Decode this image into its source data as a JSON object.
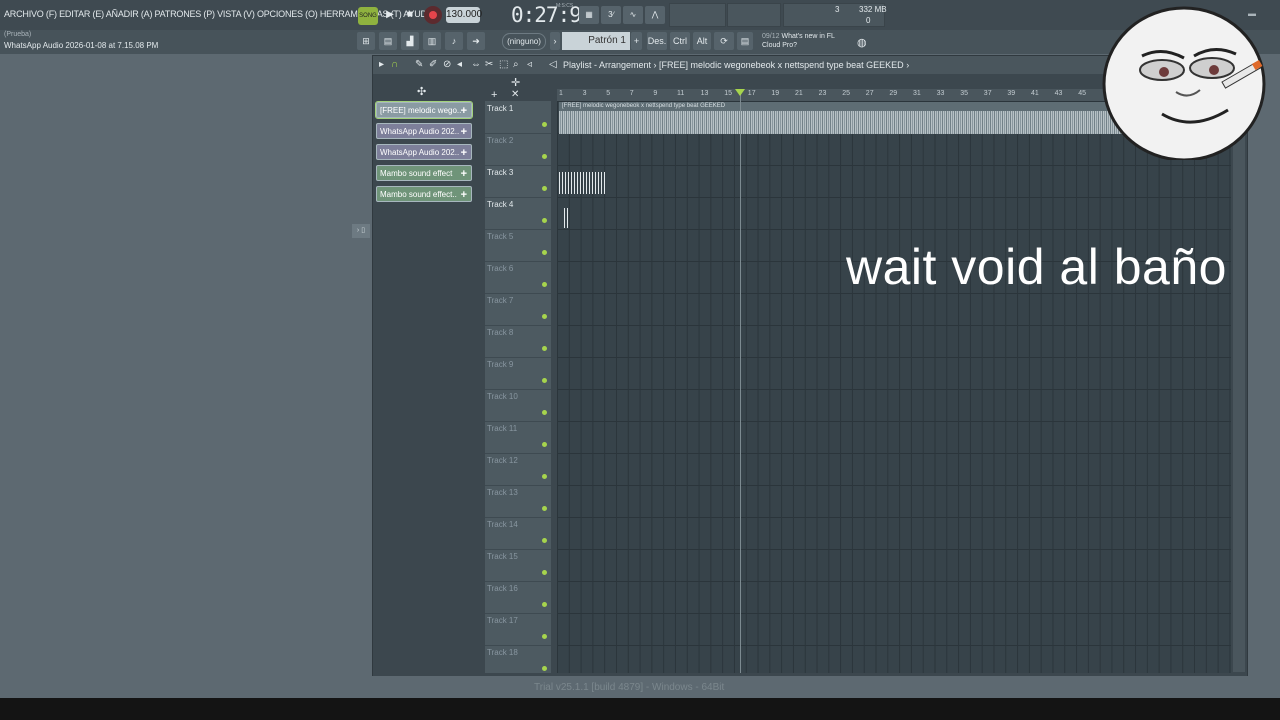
{
  "menu": {
    "items_text": "ARCHIVO (F) EDITAR (E) AÑADIR (A) PATRONES (P) VISTA (V) OPCIONES (O) HERRAMIENTAS (T) AYUDA"
  },
  "transport": {
    "song_label": "SONG",
    "play_icon": "▶",
    "stop_icon": "■",
    "tempo": "130.000",
    "time": "0:27:93",
    "time_mode": "M:S:CS",
    "cpu_value": "3",
    "memory": "332 MB",
    "poly": "0"
  },
  "hint": {
    "title": "(Prueba)",
    "file": "WhatsApp Audio 2026-01-08 at 7.15.08 PM"
  },
  "toolbar2": {
    "pattern_none": "(ninguno)",
    "pattern_name": "Patrón 1",
    "des_label": "Des.",
    "ctrl_label": "Ctrl",
    "alt_label": "Alt",
    "news_date": "09/12",
    "news_line1": "What's new in FL",
    "news_line2": "Cloud Pro?"
  },
  "playlist": {
    "title_prefix": "Playlist - Arrangement",
    "arrangement": "[FREE] melodic wegonebeok x nettspend type beat GEEKED",
    "clip_bar_label": "[FREE] melodic wegonebeok x nettspend type beat GEEKED",
    "picker": [
      {
        "label": "[FREE] melodic wego..",
        "plus": "+"
      },
      {
        "label": "WhatsApp Audio 202..",
        "plus": "+"
      },
      {
        "label": "WhatsApp Audio 202..",
        "plus": "+"
      },
      {
        "label": "Mambo sound effect",
        "plus": "+"
      },
      {
        "label": "Mambo sound effect..",
        "plus": "+"
      }
    ],
    "tracks": [
      "Track 1",
      "Track 2",
      "Track 3",
      "Track 4",
      "Track 5",
      "Track 6",
      "Track 7",
      "Track 8",
      "Track 9",
      "Track 10",
      "Track 11",
      "Track 12",
      "Track 13",
      "Track 14",
      "Track 15",
      "Track 16",
      "Track 17",
      "Track 18"
    ],
    "ruler": [
      "1",
      "3",
      "5",
      "7",
      "9",
      "11",
      "13",
      "15",
      "17",
      "19",
      "21",
      "23",
      "25",
      "27",
      "29",
      "31",
      "33",
      "35",
      "37",
      "39",
      "41",
      "43",
      "45"
    ]
  },
  "status": {
    "text": "Trial v25.1.1 [build 4879] - Windows - 64Bit"
  },
  "overlay": {
    "caption": "wait void al baño"
  }
}
